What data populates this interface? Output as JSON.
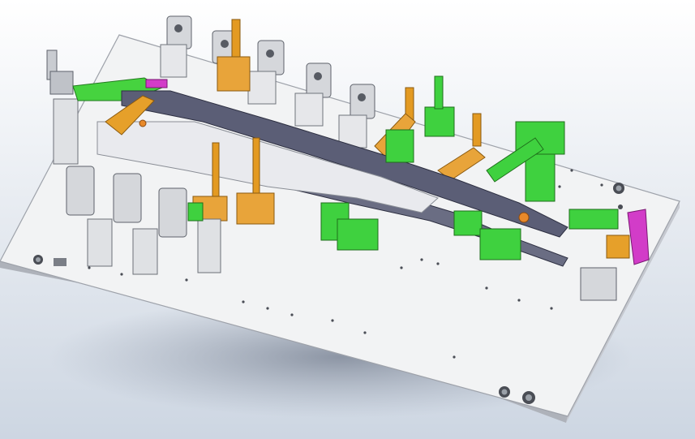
{
  "scene": {
    "subject": "welding-fixture-cad-model",
    "colors": {
      "background_top": "#ffffff",
      "background_bottom": "#cdd6e2",
      "plate": "#f2f3f4",
      "plate_edge": "#b9bcc3",
      "clamp_gray": "#d7d9dd",
      "clamp_dark": "#6b6f78",
      "locator_orange": "#e6a02a",
      "support_green": "#3fd13f",
      "rail_dark": "#5a5d73",
      "accent_magenta": "#d23cc8",
      "shadow": "#8e98a8"
    },
    "icons": [
      "toggle-clamp-icon",
      "locating-pin-icon",
      "pneumatic-cylinder-icon"
    ]
  }
}
